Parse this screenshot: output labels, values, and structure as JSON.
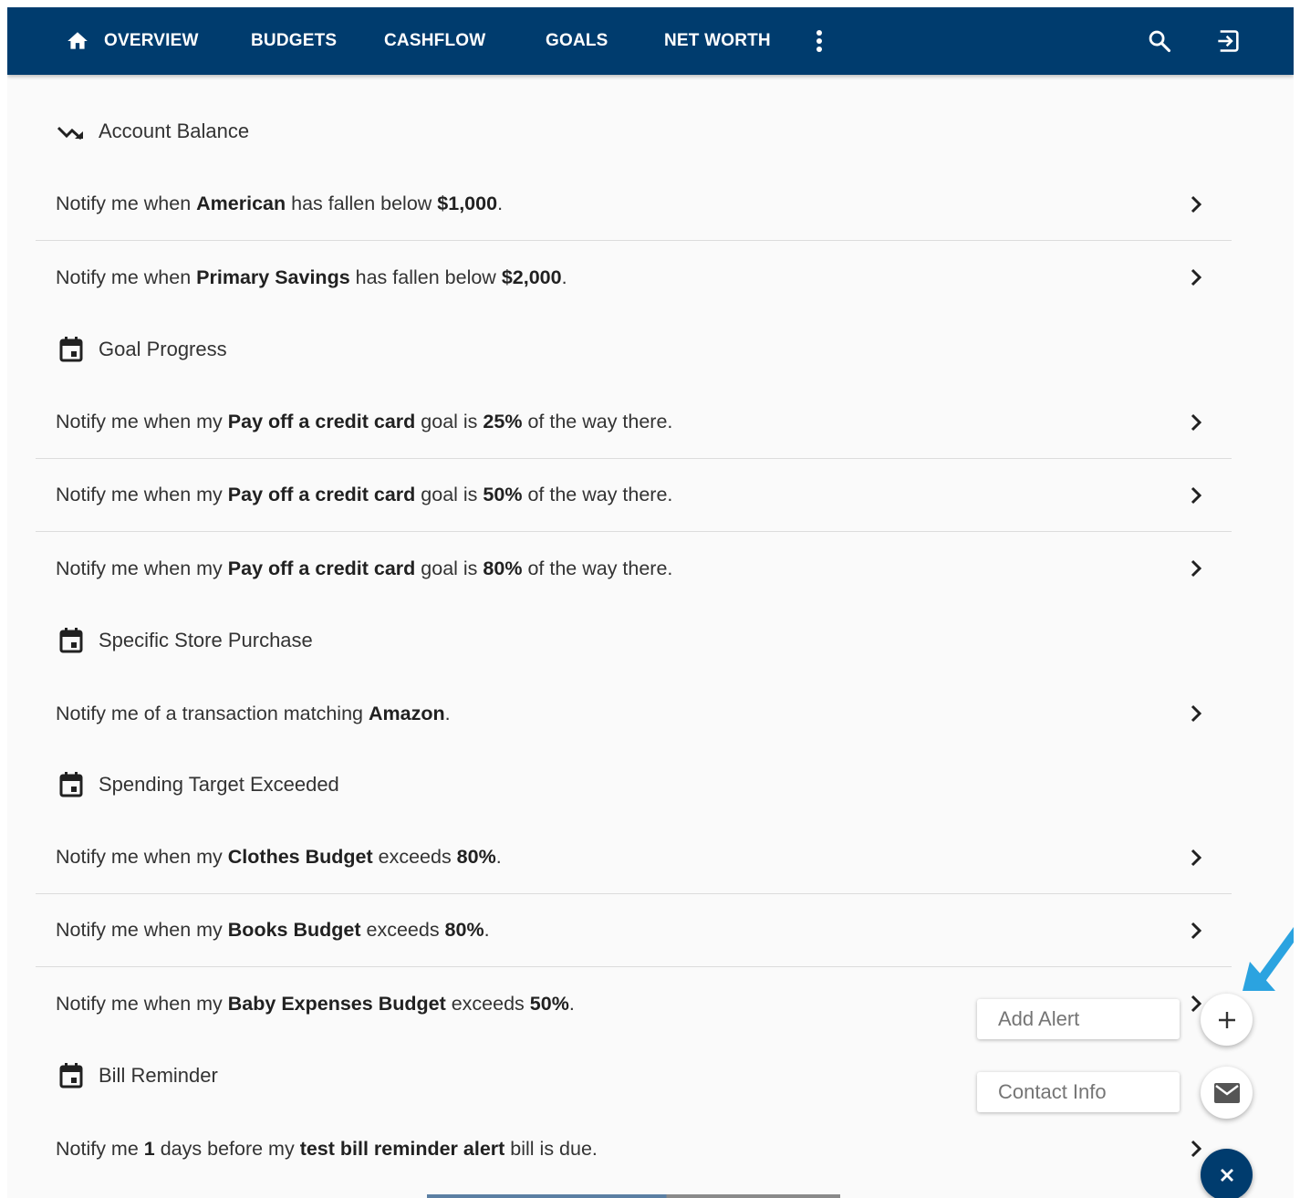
{
  "nav": {
    "overview": "OVERVIEW",
    "budgets": "BUDGETS",
    "cashflow": "CASHFLOW",
    "goals": "GOALS",
    "net_worth": "NET WORTH",
    "icons": [
      "home-icon",
      "more-vert-icon",
      "search-icon",
      "logout-icon"
    ]
  },
  "colors": {
    "nav_bg": "#003c6e",
    "page_bg": "#fafafa",
    "annotation_arrow": "#2ba3e0"
  },
  "sections": [
    {
      "title": "Account Balance",
      "icon": "trending-down-icon"
    },
    {
      "title": "Goal Progress",
      "icon": "calendar-icon"
    },
    {
      "title": "Specific Store Purchase",
      "icon": "calendar-icon"
    },
    {
      "title": "Spending Target Exceeded",
      "icon": "calendar-icon"
    },
    {
      "title": "Bill Reminder",
      "icon": "calendar-icon"
    }
  ],
  "alerts": [
    {
      "pre": "Notify me when ",
      "b1": "American",
      "mid": " has fallen below ",
      "b2": "$1,000",
      "post": "."
    },
    {
      "pre": "Notify me when ",
      "b1": "Primary Savings",
      "mid": " has fallen below ",
      "b2": "$2,000",
      "post": "."
    },
    {
      "pre": "Notify me when my ",
      "b1": "Pay off a credit card",
      "mid": " goal is ",
      "b2": "25%",
      "post": " of the way there."
    },
    {
      "pre": "Notify me when my ",
      "b1": "Pay off a credit card",
      "mid": " goal is ",
      "b2": "50%",
      "post": " of the way there."
    },
    {
      "pre": "Notify me when my ",
      "b1": "Pay off a credit card",
      "mid": " goal is ",
      "b2": "80%",
      "post": " of the way there."
    },
    {
      "pre": "Notify me of a transaction matching ",
      "b1": "Amazon",
      "post": "."
    },
    {
      "pre": "Notify me when my ",
      "b1": "Clothes Budget",
      "mid": " exceeds ",
      "b2": "80%",
      "post": "."
    },
    {
      "pre": "Notify me when my ",
      "b1": "Books Budget",
      "mid": " exceeds ",
      "b2": "80%",
      "post": "."
    },
    {
      "pre": "Notify me when my ",
      "b1": "Baby Expenses Budget",
      "mid": " exceeds ",
      "b2": "50%",
      "post": "."
    },
    {
      "pre": "Notify me ",
      "b1": "1",
      "mid": " days before my ",
      "b2": "test bill reminder alert",
      "post": " bill is due."
    }
  ],
  "fab": {
    "add_alert": "Add Alert",
    "contact_info": "Contact Info",
    "icons": [
      "add-icon",
      "mail-icon",
      "close-icon"
    ]
  }
}
